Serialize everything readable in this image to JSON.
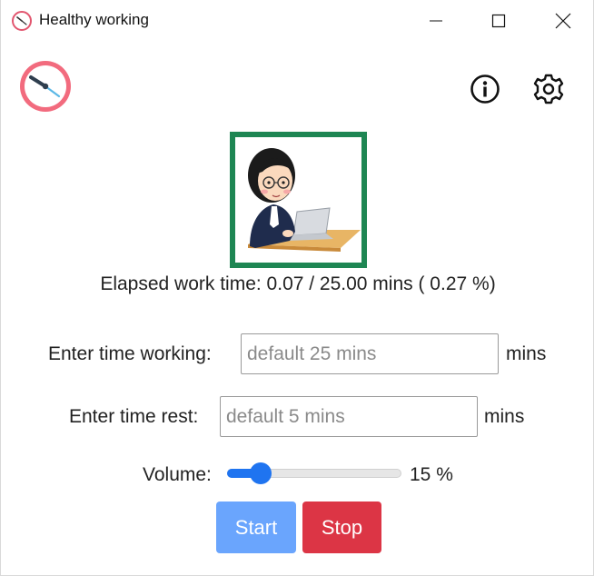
{
  "window": {
    "title": "Healthy working"
  },
  "header": {
    "app_icon": "alarm-clock-icon",
    "info_icon": "info-icon",
    "settings_icon": "gear-icon"
  },
  "status": {
    "illustration": "person-working-at-laptop",
    "frame_color": "#1e8653",
    "elapsed_text": "Elapsed work time: 0.07 / 25.00 mins ( 0.27 %)"
  },
  "form": {
    "work_label": "Enter time working:",
    "work_placeholder": "default 25 mins",
    "work_value": "",
    "work_unit": "mins",
    "rest_label": "Enter time rest:",
    "rest_placeholder": "default 5 mins",
    "rest_value": "",
    "rest_unit": "mins",
    "volume_label": "Volume:",
    "volume_level_percent": 15,
    "volume_text": "15 %"
  },
  "buttons": {
    "start_label": "Start",
    "start_color": "#6aa5fd",
    "stop_label": "Stop",
    "stop_color": "#dc3545"
  }
}
